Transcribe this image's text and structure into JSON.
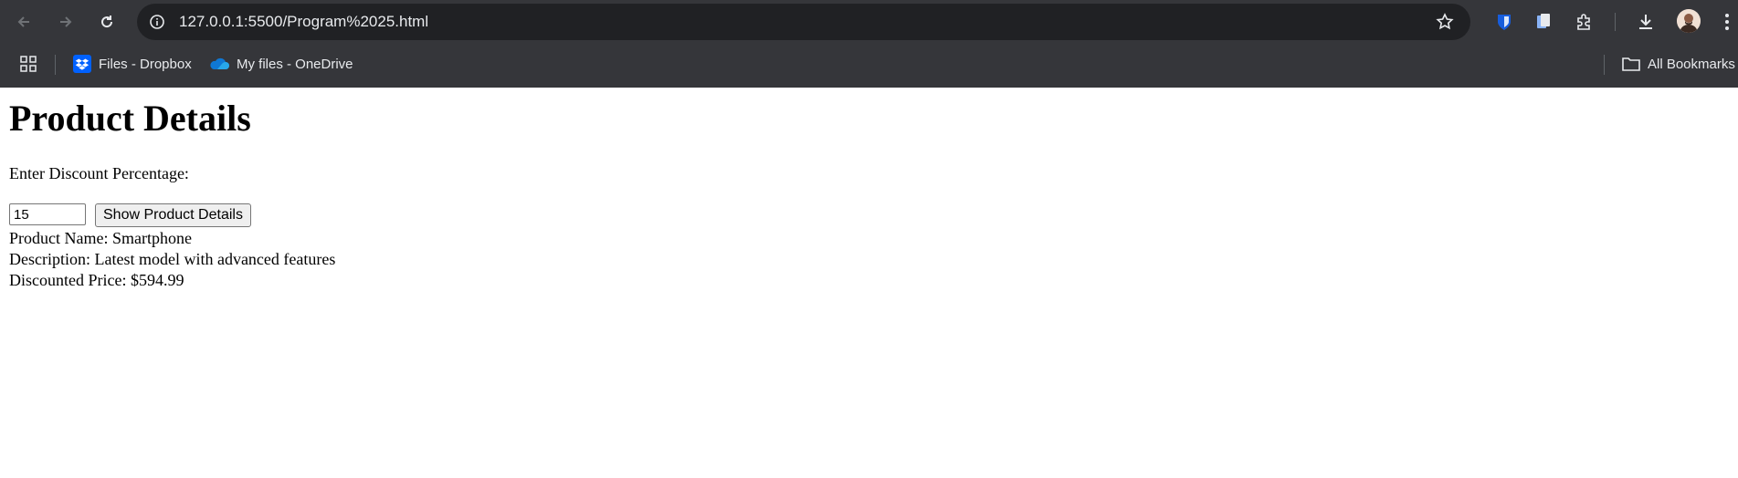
{
  "browser": {
    "url": "127.0.0.1:5500/Program%2025.html",
    "bookmarks": [
      {
        "label": "Files - Dropbox",
        "icon": "dropbox-icon"
      },
      {
        "label": "My files - OneDrive",
        "icon": "onedrive-icon"
      }
    ],
    "all_bookmarks_label": "All Bookmarks",
    "colors": {
      "toolbar": "#35363a",
      "omnibox": "#202124",
      "text": "#e8eaed",
      "dropbox": "#0061fe",
      "onedrive": "#0f78d4"
    }
  },
  "page": {
    "title": "Product Details",
    "discount_label": "Enter Discount Percentage:",
    "discount_value": "15",
    "button_label": "Show Product Details",
    "details": {
      "name": "Product Name: Smartphone",
      "description": "Description: Latest model with advanced features",
      "price": "Discounted Price: $594.99"
    }
  }
}
